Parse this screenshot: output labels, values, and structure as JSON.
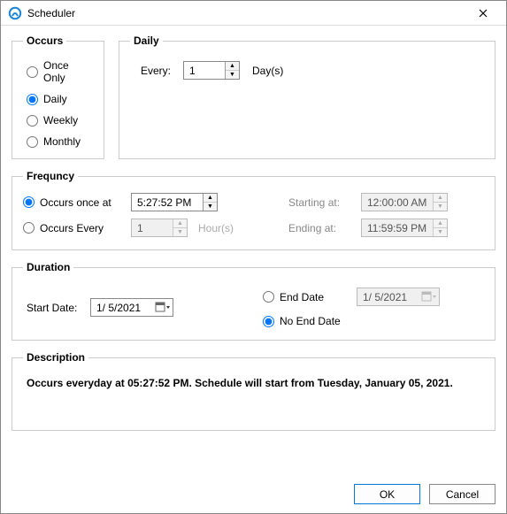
{
  "window": {
    "title": "Scheduler"
  },
  "occurs": {
    "legend": "Occurs",
    "options": {
      "once": "Once Only",
      "daily": "Daily",
      "weekly": "Weekly",
      "monthly": "Monthly"
    },
    "selected": "daily"
  },
  "daily": {
    "legend": "Daily",
    "every_label": "Every:",
    "every_value": "1",
    "unit": "Day(s)"
  },
  "frequency": {
    "legend": "Frequncy",
    "once_label": "Occurs once at",
    "once_value": "5:27:52 PM",
    "every_label": "Occurs Every",
    "every_value": "1",
    "every_unit": "Hour(s)",
    "starting_label": "Starting at:",
    "starting_value": "12:00:00 AM",
    "ending_label": "Ending at:",
    "ending_value": "11:59:59 PM",
    "selected": "once"
  },
  "duration": {
    "legend": "Duration",
    "start_label": "Start Date:",
    "start_value": "1/ 5/2021",
    "end_label": "End Date",
    "end_value": "1/ 5/2021",
    "noend_label": "No End Date",
    "end_selected": "noend"
  },
  "description": {
    "legend": "Description",
    "text": "Occurs everyday at 05:27:52 PM. Schedule will start from Tuesday, January 05, 2021."
  },
  "footer": {
    "ok": "OK",
    "cancel": "Cancel"
  }
}
